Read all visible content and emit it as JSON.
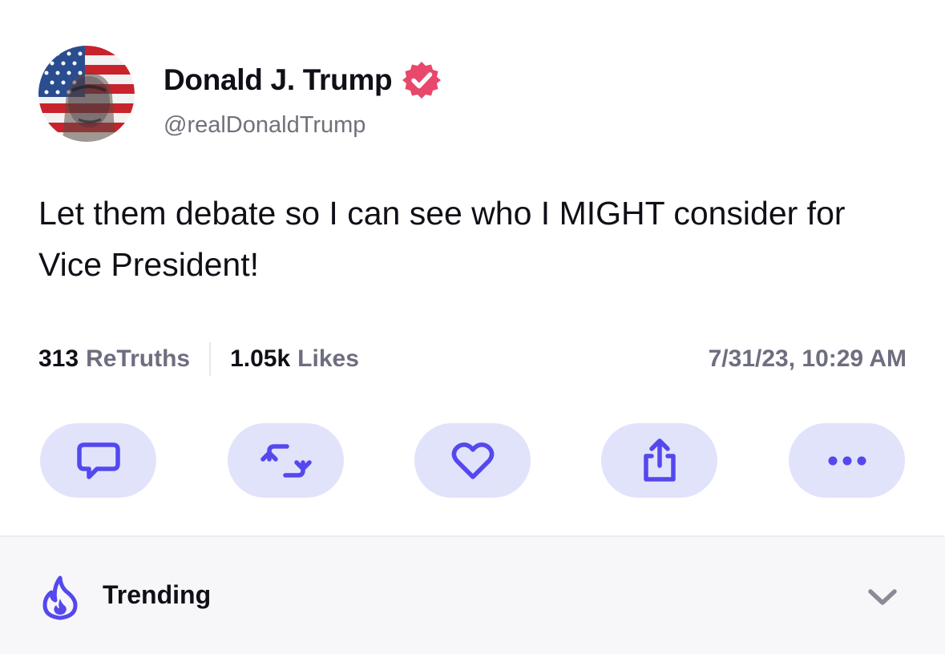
{
  "post": {
    "author": {
      "display_name": "Donald J. Trump",
      "handle": "@realDonaldTrump",
      "verified": true,
      "verified_badge_color": "#e8486b",
      "avatar_icon": "profile-avatar"
    },
    "text": "Let them debate so I can see who I MIGHT consider for Vice President!",
    "stats": {
      "retruths_count": "313",
      "retruths_label": "ReTruths",
      "likes_count": "1.05k",
      "likes_label": "Likes",
      "timestamp": "7/31/23, 10:29 AM"
    },
    "actions": [
      {
        "name": "reply",
        "icon": "comment-icon"
      },
      {
        "name": "retruth",
        "icon": "repost-icon"
      },
      {
        "name": "like",
        "icon": "heart-icon"
      },
      {
        "name": "share",
        "icon": "share-icon"
      },
      {
        "name": "more",
        "icon": "more-icon"
      }
    ]
  },
  "trending": {
    "label": "Trending",
    "icon": "flame-icon",
    "toggle_icon": "chevron-down-icon"
  },
  "colors": {
    "accent": "#5448ee",
    "action_bg": "#e1e3fb",
    "muted_text": "#6e6e80",
    "trending_bg": "#f7f7f9"
  }
}
